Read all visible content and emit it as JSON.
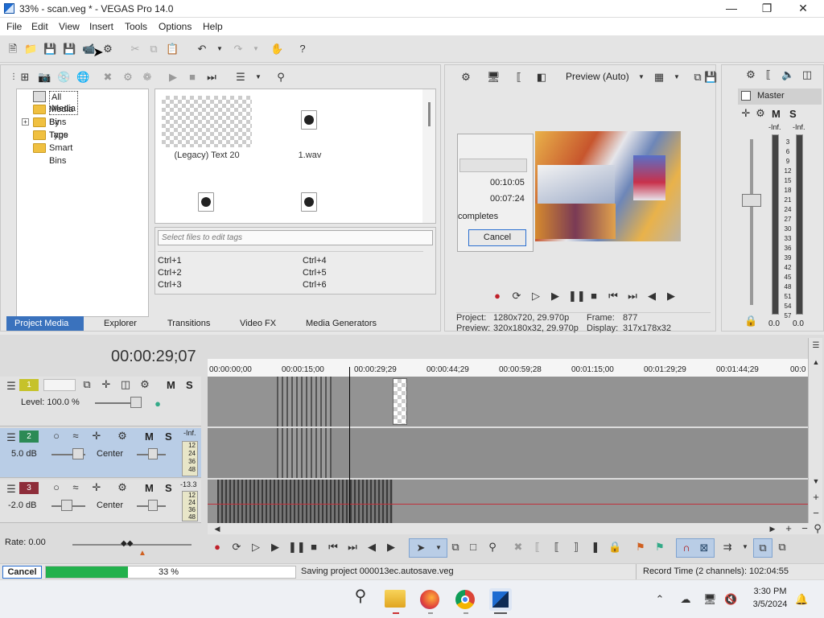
{
  "window": {
    "title": "33% - scan.veg * - VEGAS Pro 14.0"
  },
  "menu": [
    "File",
    "Edit",
    "View",
    "Insert",
    "Tools",
    "Options",
    "Help"
  ],
  "media": {
    "tree": [
      "All Media",
      "Media Bins",
      "By Type",
      "Tags",
      "Smart Bins"
    ],
    "tree_expand": "+",
    "items": [
      "(Legacy) Text 20",
      "1.wav"
    ],
    "tags_placeholder": "Select files to edit tags",
    "shortcuts": [
      "Ctrl+1",
      "Ctrl+4",
      "Ctrl+2",
      "Ctrl+5",
      "Ctrl+3",
      "Ctrl+6"
    ],
    "tabs": [
      "Project Media",
      "Explorer",
      "Transitions",
      "Video FX",
      "Media Generators"
    ]
  },
  "preview": {
    "mode": "Preview (Auto)",
    "dialog_time1": "00:10:05",
    "dialog_time2": "00:07:24",
    "dialog_text": "completes",
    "cancel": "Cancel",
    "project_label": "Project:",
    "project_value": "1280x720, 29.970p",
    "frame_label": "Frame:",
    "frame_value": "877",
    "preview_label": "Preview:",
    "preview_value": "320x180x32, 29.970p",
    "display_label": "Display:",
    "display_value": "317x178x32"
  },
  "master": {
    "title": "Master",
    "m": "M",
    "s": "S",
    "inf_left": "-Inf.",
    "inf_right": "-Inf.",
    "scale": [
      "3",
      "6",
      "9",
      "12",
      "15",
      "18",
      "21",
      "24",
      "27",
      "30",
      "33",
      "36",
      "39",
      "42",
      "45",
      "48",
      "51",
      "54",
      "57"
    ],
    "val_left": "0.0",
    "val_right": "0.0"
  },
  "timeline": {
    "timecode": "00:00:29;07",
    "ruler": [
      "00:00:00;00",
      "00:00:15;00",
      "00:00:29;29",
      "00:00:44;29",
      "00:00:59;28",
      "00:01:15;00",
      "00:01:29;29",
      "00:01:44;29",
      "00:0"
    ],
    "tracks": [
      {
        "num": "1",
        "level": "Level: 100.0 %"
      },
      {
        "num": "2",
        "vol": "5.0 dB",
        "pan": "Center",
        "meter_top": "-Inf.",
        "meter": [
          "12",
          "24",
          "36",
          "48"
        ]
      },
      {
        "num": "3",
        "vol": "-2.0 dB",
        "pan": "Center",
        "meter_top": "-13.3",
        "meter": [
          "12",
          "24",
          "36",
          "48"
        ]
      }
    ],
    "m": "M",
    "s": "S",
    "rate": "Rate: 0.00"
  },
  "status": {
    "cancel": "Cancel",
    "progress_pct": 33,
    "progress_text": "33 %",
    "message": "Saving project 000013ec.autosave.veg",
    "record": "Record Time (2 channels): 102:04:55"
  },
  "taskbar": {
    "time": "3:30 PM",
    "date": "3/5/2024"
  },
  "colors": {
    "accent": "#1d6bd1",
    "progress": "#22b14c",
    "selected_track": "#b9cde6"
  }
}
